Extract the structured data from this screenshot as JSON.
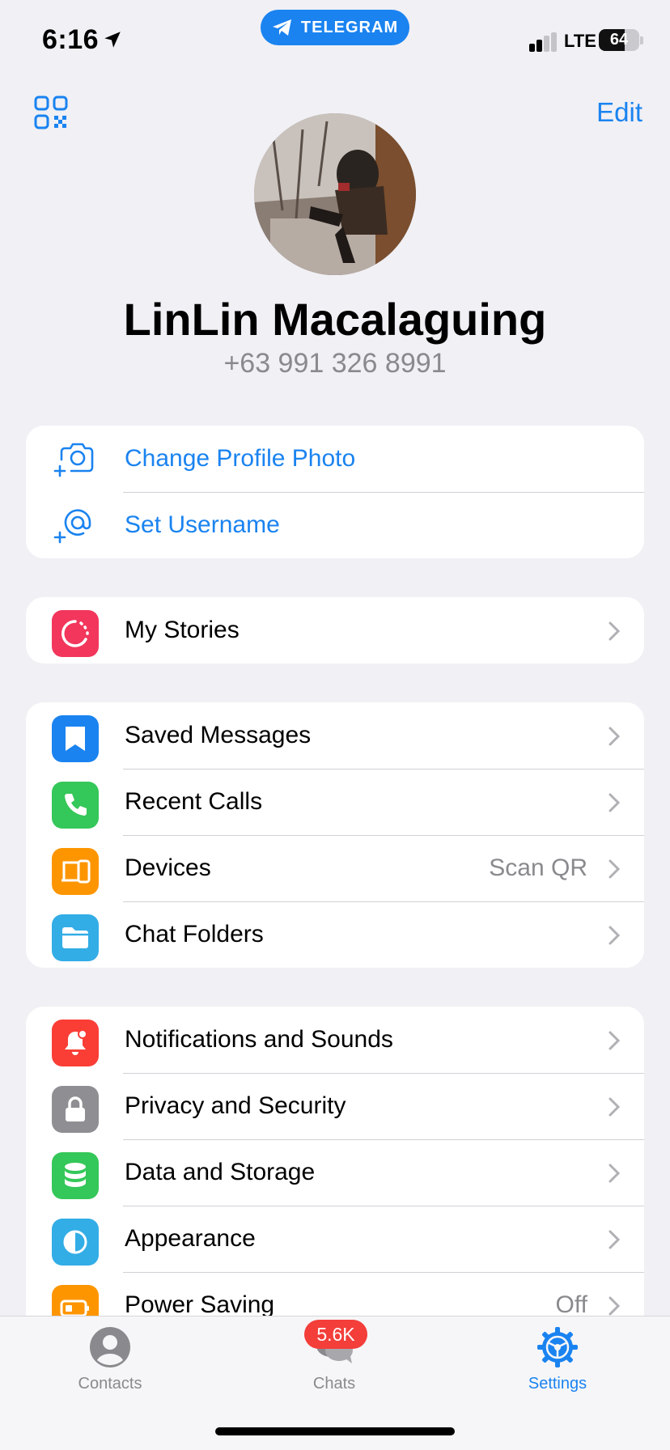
{
  "status_bar": {
    "time": "6:16",
    "app_pill": "TELEGRAM",
    "network": "LTE",
    "battery": "64",
    "battery_level": 0.64
  },
  "header": {
    "edit_label": "Edit"
  },
  "profile": {
    "name": "LinLin Macalaguing",
    "phone": "+63 991 326 8991"
  },
  "account_group": [
    {
      "label": "Change Profile Photo",
      "icon": "add-photo-icon"
    },
    {
      "label": "Set Username",
      "icon": "add-username-icon"
    }
  ],
  "stories_group": [
    {
      "label": "My Stories",
      "icon": "stories-icon",
      "color": "#f2365c"
    }
  ],
  "main_group": [
    {
      "label": "Saved Messages",
      "icon": "bookmark-icon",
      "color": "#1a83f0"
    },
    {
      "label": "Recent Calls",
      "icon": "phone-icon",
      "color": "#34c759"
    },
    {
      "label": "Devices",
      "value": "Scan QR",
      "icon": "devices-icon",
      "color": "#fd9500"
    },
    {
      "label": "Chat Folders",
      "icon": "folder-icon",
      "color": "#32ade6"
    }
  ],
  "settings_group": [
    {
      "label": "Notifications and Sounds",
      "icon": "bell-icon",
      "color": "#fa3e36"
    },
    {
      "label": "Privacy and Security",
      "icon": "lock-icon",
      "color": "#8e8e93"
    },
    {
      "label": "Data and Storage",
      "icon": "database-icon",
      "color": "#34c759"
    },
    {
      "label": "Appearance",
      "icon": "half-circle-icon",
      "color": "#32ade6"
    },
    {
      "label": "Power Saving",
      "value": "Off",
      "icon": "battery-icon",
      "color": "#fd9500"
    }
  ],
  "tabbar": {
    "tabs": [
      {
        "label": "Contacts",
        "icon": "person-icon"
      },
      {
        "label": "Chats",
        "icon": "chat-bubbles-icon",
        "badge": "5.6K"
      },
      {
        "label": "Settings",
        "icon": "gear-icon",
        "active": true
      }
    ]
  },
  "colors": {
    "accent": "#1a83f0",
    "background": "#f0f0f5",
    "badge": "#f33e3a"
  }
}
